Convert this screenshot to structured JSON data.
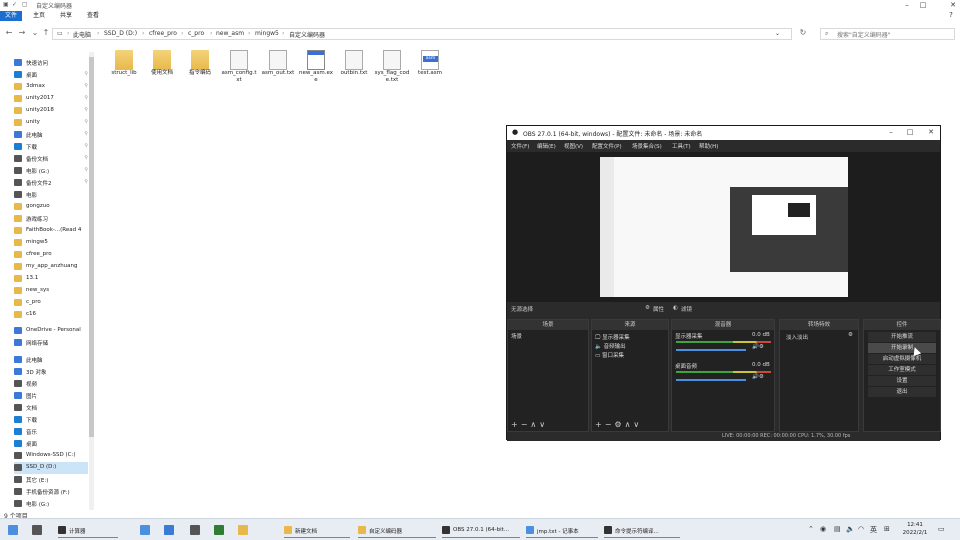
{
  "explorer": {
    "title": "自定义编码器",
    "ribbon_tabs": [
      "文件",
      "主页",
      "共享",
      "查看"
    ],
    "breadcrumb": [
      "此电脑",
      "SSD_D (D:)",
      "cfree_pro",
      "c_pro",
      "new_asm",
      "mingw5",
      "自定义编码器"
    ],
    "search_placeholder": "搜索\"自定义编码器\"",
    "nav_items": [
      {
        "label": "快速访问",
        "color": "#3b78d8",
        "pin": false
      },
      {
        "label": "桌面",
        "color": "#1b7fd4",
        "pin": true
      },
      {
        "label": "3dmax",
        "color": "#e8b84a",
        "pin": true
      },
      {
        "label": "unity2017",
        "color": "#e8b84a",
        "pin": true
      },
      {
        "label": "unity2018",
        "color": "#e8b84a",
        "pin": true
      },
      {
        "label": "unity",
        "color": "#e8b84a",
        "pin": true
      },
      {
        "label": "此电脑",
        "color": "#3b78d8",
        "pin": true
      },
      {
        "label": "下载",
        "color": "#1b7fd4",
        "pin": true
      },
      {
        "label": "备份文档",
        "color": "#555555",
        "pin": true
      },
      {
        "label": "电影 (G:)",
        "color": "#555555",
        "pin": true
      },
      {
        "label": "备份文件2",
        "color": "#555555",
        "pin": true
      },
      {
        "label": "电影",
        "color": "#555555",
        "pin": false
      },
      {
        "label": "gongzuo",
        "color": "#e8b84a",
        "pin": false
      },
      {
        "label": "游戏练习",
        "color": "#e8b84a",
        "pin": false
      },
      {
        "label": "FaithBook-...(Read 4",
        "color": "#e8b84a",
        "pin": false
      },
      {
        "label": "mingw5",
        "color": "#e8b84a",
        "pin": false
      },
      {
        "label": "cfree_pro",
        "color": "#e8b84a",
        "pin": false
      },
      {
        "label": "my_app_anzhuang",
        "color": "#e8b84a",
        "pin": false
      },
      {
        "label": "13.1",
        "color": "#e8b84a",
        "pin": false
      },
      {
        "label": "new_sys",
        "color": "#e8b84a",
        "pin": false
      },
      {
        "label": "c_pro",
        "color": "#e8b84a",
        "pin": false
      },
      {
        "label": "c16",
        "color": "#e8b84a",
        "pin": false
      },
      {
        "label": "OneDrive - Personal",
        "color": "#3b78d8",
        "pin": false
      },
      {
        "label": "网络存储",
        "color": "#3b78d8",
        "pin": false
      },
      {
        "label": "此电脑",
        "color": "#3b78d8",
        "pin": false
      },
      {
        "label": "3D 对象",
        "color": "#3b78d8",
        "pin": false
      },
      {
        "label": "视频",
        "color": "#555555",
        "pin": false
      },
      {
        "label": "图片",
        "color": "#3b78d8",
        "pin": false
      },
      {
        "label": "文档",
        "color": "#555555",
        "pin": false
      },
      {
        "label": "下载",
        "color": "#1b7fd4",
        "pin": false
      },
      {
        "label": "音乐",
        "color": "#1b7fd4",
        "pin": false
      },
      {
        "label": "桌面",
        "color": "#1b7fd4",
        "pin": false
      },
      {
        "label": "Windows-SSD (C:)",
        "color": "#555555",
        "pin": false
      },
      {
        "label": "SSD_D (D:)",
        "color": "#555555",
        "pin": false,
        "selected": true
      },
      {
        "label": "其它 (E:)",
        "color": "#555555",
        "pin": false
      },
      {
        "label": "手机备份资源 (F:)",
        "color": "#555555",
        "pin": false
      },
      {
        "label": "电影 (G:)",
        "color": "#555555",
        "pin": false
      }
    ],
    "files": [
      {
        "name": "struct_lib",
        "type": "folder"
      },
      {
        "name": "使用文档",
        "type": "folder"
      },
      {
        "name": "指令编码",
        "type": "folder"
      },
      {
        "name": "asm_config.txt",
        "type": "doc"
      },
      {
        "name": "asm_out.txt",
        "type": "doc"
      },
      {
        "name": "new_asm.exe",
        "type": "exe"
      },
      {
        "name": "outbin.txt",
        "type": "doc"
      },
      {
        "name": "sys_flag_code.txt",
        "type": "doc"
      },
      {
        "name": "test.asm",
        "type": "asm",
        "tag": "asm"
      }
    ],
    "status": "9 个项目"
  },
  "obs": {
    "title": "OBS 27.0.1 (64-bit, windows) - 配置文件: 未命名 - 场景: 未命名",
    "menu": [
      "文件(F)",
      "编辑(E)",
      "视图(V)",
      "配置文件(P)",
      "场景集合(S)",
      "工具(T)",
      "帮助(H)"
    ],
    "scene_bar": "无源选择",
    "scene_bar_props": "属性",
    "scene_bar_filters": "滤镜",
    "docks": {
      "scenes": {
        "header": "场景",
        "items": [
          "场景"
        ]
      },
      "sources": {
        "header": "来源",
        "items": [
          "显示器采集",
          "音频输出",
          "窗口采集"
        ]
      },
      "mixer": {
        "header": "混音器",
        "channels": [
          "显示器采集",
          "桌面音频"
        ],
        "level_db": "0.0 dB"
      },
      "transitions": {
        "header": "转场特效",
        "item": "淡入淡出"
      },
      "controls": {
        "header": "控件",
        "buttons": [
          "开始推流",
          "开始录制",
          "启动虚拟摄像机",
          "工作室模式",
          "设置",
          "退出"
        ]
      }
    },
    "stats": "LIVE: 00:00:00   REC: 00:00:00   CPU: 1.7%, 30.00 fps"
  },
  "taskbar": {
    "apps": [
      {
        "label": "计算器",
        "color": "#333333"
      },
      {
        "label": "新建文档",
        "color": "#e8b84a"
      },
      {
        "label": "自定义编码器",
        "color": "#e8b84a"
      },
      {
        "label": "OBS 27.0.1 (64-bit...",
        "color": "#333333"
      },
      {
        "label": "jmp.txt - 记事本",
        "color": "#4a8fe0"
      },
      {
        "label": "命令提示符编译...",
        "color": "#333333"
      }
    ],
    "ime": "英",
    "time": "12:41",
    "date": "2022/2/1"
  }
}
